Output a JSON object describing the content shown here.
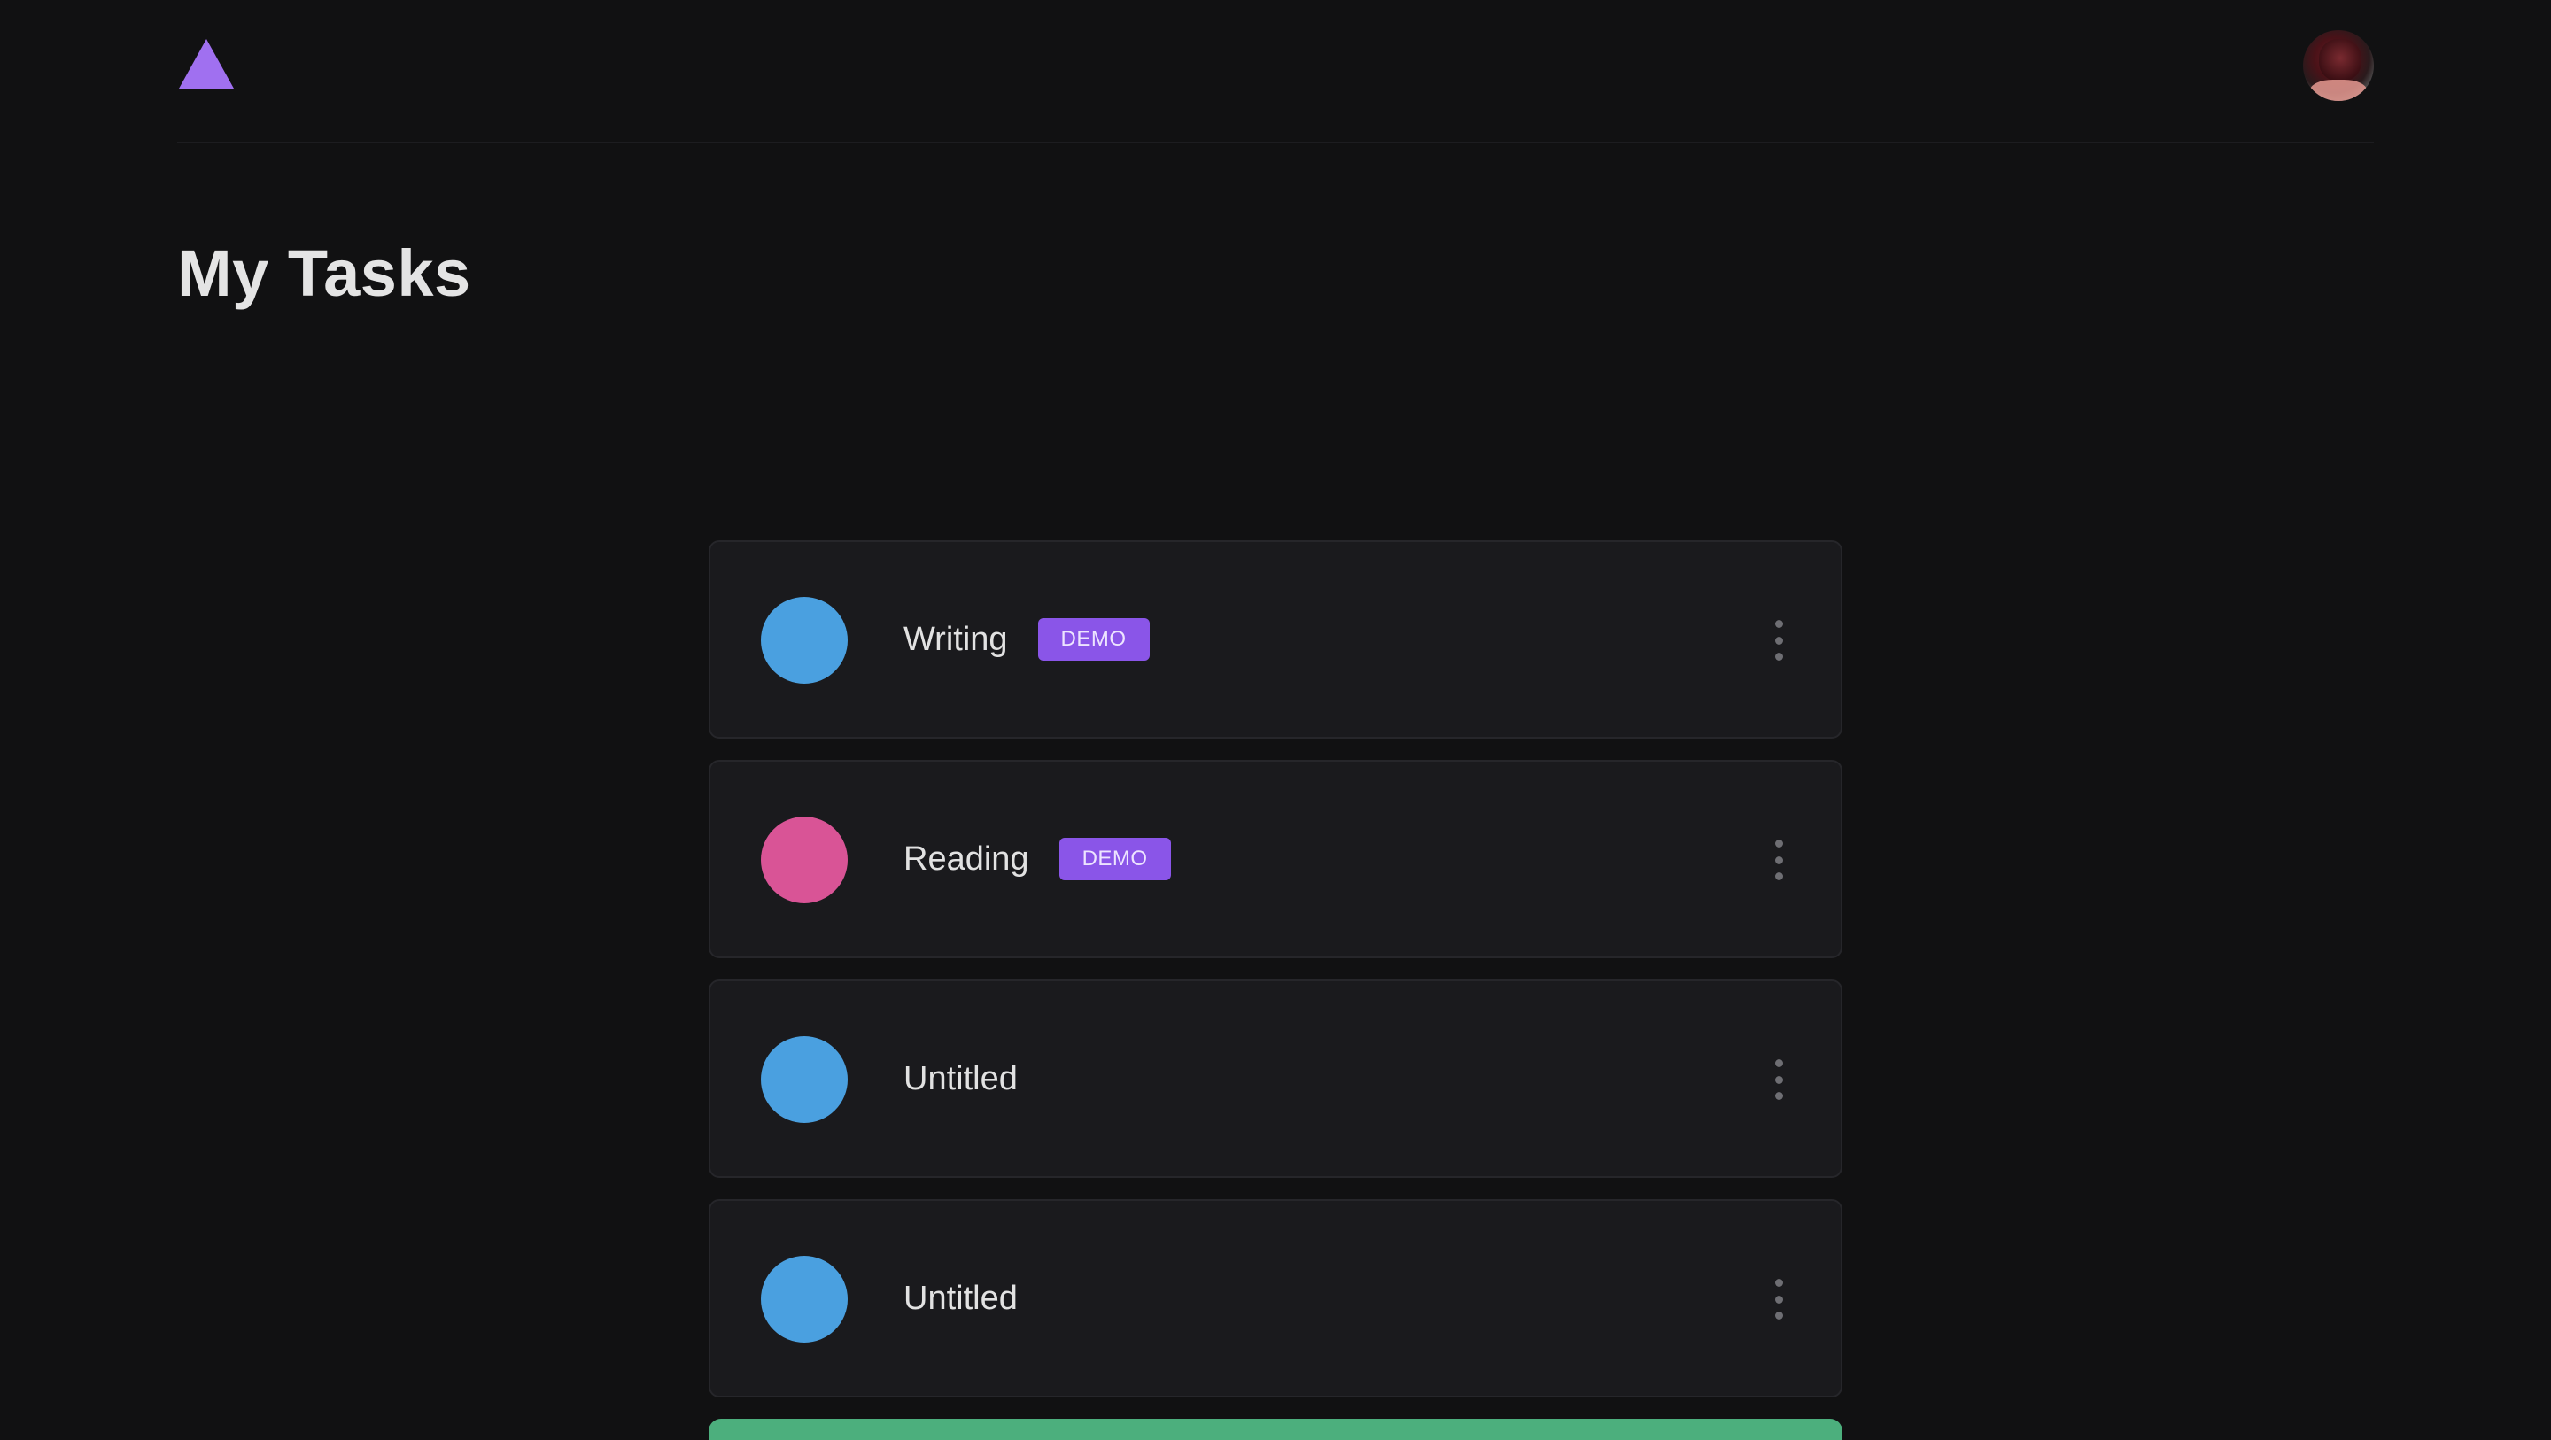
{
  "header": {
    "logo_icon": "triangle-logo-icon",
    "logo_color": "#a070f0",
    "avatar_icon": "user-avatar"
  },
  "page_title": "My Tasks",
  "tasks": [
    {
      "title": "Writing",
      "badge": "DEMO",
      "color": "#4aa0e0",
      "menu_icon": "more-vertical-icon"
    },
    {
      "title": "Reading",
      "badge": "DEMO",
      "color": "#d95496",
      "menu_icon": "more-vertical-icon"
    },
    {
      "title": "Untitled",
      "badge": "",
      "color": "#4aa0e0",
      "menu_icon": "more-vertical-icon"
    },
    {
      "title": "Untitled",
      "badge": "",
      "color": "#4aa0e0",
      "menu_icon": "more-vertical-icon"
    }
  ],
  "add_button": {
    "color": "#4caf7d"
  },
  "colors": {
    "background": "#111112",
    "card": "#1a1a1d",
    "badge": "#8a55e8"
  }
}
